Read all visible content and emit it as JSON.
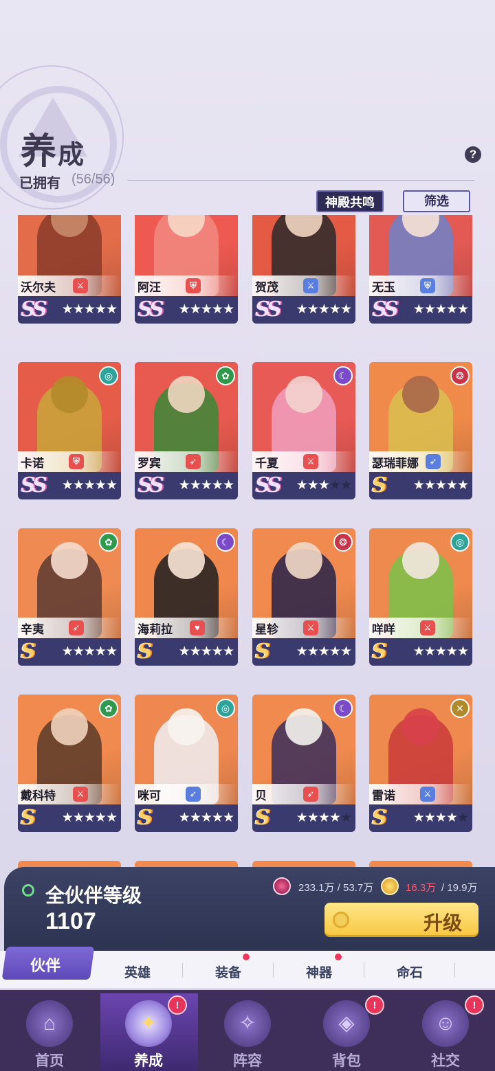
{
  "header": {
    "title_big": "养",
    "title_small": "成",
    "owned_label": "已拥有",
    "owned_count": "(56/56)",
    "help": "?",
    "temple_button": "神殿共鸣",
    "filter_button": "筛选"
  },
  "companions": [
    {
      "name": "沃尔夫",
      "rank": "SS",
      "stars": 5,
      "role_icon": "sword-icon",
      "role_color": "#e85050",
      "elem_icon": "",
      "bg": "#e36d4a",
      "figure": "#8a3a2a",
      "head": "#c98a6a"
    },
    {
      "name": "阿汪",
      "rank": "SS",
      "stars": 5,
      "role_icon": "shield-icon",
      "role_color": "#e85050",
      "elem_icon": "",
      "bg": "#ee5a52",
      "figure": "#f08a80",
      "head": "#f6d7c6"
    },
    {
      "name": "贺茂",
      "rank": "SS",
      "stars": 5,
      "role_icon": "sword-icon",
      "role_color": "#5a7de0",
      "elem_icon": "",
      "bg": "#e35a45",
      "figure": "#2a2a2a",
      "head": "#f2d6c2"
    },
    {
      "name": "无玉",
      "rank": "SS",
      "stars": 5,
      "role_icon": "shield-icon",
      "role_color": "#5a7de0",
      "elem_icon": "",
      "bg": "#e35a55",
      "figure": "#6f83c9",
      "head": "#f6e2d6"
    },
    {
      "name": "卡诺",
      "rank": "SS",
      "stars": 5,
      "role_icon": "shield-icon",
      "role_color": "#e85050",
      "elem_icon": "wind-icon",
      "elem_color": "#2ea39a",
      "bg": "#e55d49",
      "figure": "#c9a43a",
      "head": "#b48a2a"
    },
    {
      "name": "罗宾",
      "rank": "SS",
      "stars": 5,
      "role_icon": "bow-icon",
      "role_color": "#e85050",
      "elem_icon": "leaf-icon",
      "elem_color": "#2f9a4e",
      "bg": "#e85a4f",
      "figure": "#3a8a3a",
      "head": "#f0d6c0"
    },
    {
      "name": "千夏",
      "rank": "SS",
      "stars": 3,
      "role_icon": "sword-icon",
      "role_color": "#e85050",
      "elem_icon": "moon-icon",
      "elem_color": "#7a4ac8",
      "bg": "#e85a55",
      "figure": "#f0a0c0",
      "head": "#f3d2cf"
    },
    {
      "name": "瑟瑞菲娜",
      "rank": "S",
      "stars": 5,
      "role_icon": "bow-icon",
      "role_color": "#5a7de0",
      "elem_icon": "fire-icon",
      "elem_color": "#c8344a",
      "bg": "#f08a4a",
      "figure": "#d8c050",
      "head": "#a8684a"
    },
    {
      "name": "辛夷",
      "rank": "S",
      "stars": 5,
      "role_icon": "bow-icon",
      "role_color": "#e85050",
      "elem_icon": "leaf-icon",
      "elem_color": "#2f9a4e",
      "bg": "#ef8b52",
      "figure": "#5a3a32",
      "head": "#f5dccd"
    },
    {
      "name": "海莉拉",
      "rank": "S",
      "stars": 5,
      "role_icon": "heart-icon",
      "role_color": "#e85050",
      "elem_icon": "moon-icon",
      "elem_color": "#7a4ac8",
      "bg": "#f0884e",
      "figure": "#1e1e22",
      "head": "#f8e6d6"
    },
    {
      "name": "星轸",
      "rank": "S",
      "stars": 5,
      "role_icon": "sword-icon",
      "role_color": "#e85050",
      "elem_icon": "fire-icon",
      "elem_color": "#c8344a",
      "bg": "#f08a4e",
      "figure": "#26224a",
      "head": "#f2d8c8"
    },
    {
      "name": "咩咩",
      "rank": "S",
      "stars": 5,
      "role_icon": "sword-icon",
      "role_color": "#e85050",
      "elem_icon": "wind-icon",
      "elem_color": "#2ea39a",
      "bg": "#ef8a4e",
      "figure": "#7ac24a",
      "head": "#f2e8e0"
    },
    {
      "name": "戴科特",
      "rank": "S",
      "stars": 5,
      "role_icon": "sword-icon",
      "role_color": "#e85050",
      "elem_icon": "leaf-icon",
      "elem_color": "#2f9a4e",
      "bg": "#f08a4e",
      "figure": "#5a3a2a",
      "head": "#f0d2bc"
    },
    {
      "name": "咪可",
      "rank": "S",
      "stars": 5,
      "role_icon": "bow-icon",
      "role_color": "#5a7de0",
      "elem_icon": "wind-icon",
      "elem_color": "#2ea39a",
      "bg": "#ef8850",
      "figure": "#eef0f4",
      "head": "#f8f4f0"
    },
    {
      "name": "贝",
      "rank": "S",
      "stars": 4,
      "role_icon": "bow-icon",
      "role_color": "#e85050",
      "elem_icon": "moon-icon",
      "elem_color": "#7a4ac8",
      "bg": "#f08a4e",
      "figure": "#3a2e5a",
      "head": "#f4f2f0"
    },
    {
      "name": "雷诺",
      "rank": "S",
      "stars": 4,
      "role_icon": "sword-icon",
      "role_color": "#5a7de0",
      "elem_icon": "cross-icon",
      "elem_color": "#b08a2a",
      "bg": "#ef8a4e",
      "figure": "#c83a3a",
      "head": "#d8404a"
    }
  ],
  "panel": {
    "title": "全伙伴等级",
    "level": "1107",
    "res1": "233.1万 / 53.7万",
    "res2_have": "16.3万",
    "res2_need": "/ 19.9万",
    "upgrade": "升级"
  },
  "subtabs": {
    "active": "伙伴",
    "heroes": "英雄",
    "equipment": "装备",
    "artifacts": "神器",
    "fate_stone": "命石"
  },
  "nav": [
    {
      "label": "首页",
      "icon": "home-icon",
      "glyph": "⌂"
    },
    {
      "label": "养成",
      "icon": "cultivate-icon",
      "glyph": "✦"
    },
    {
      "label": "阵容",
      "icon": "lineup-icon",
      "glyph": "✧"
    },
    {
      "label": "背包",
      "icon": "bag-icon",
      "glyph": "◈"
    },
    {
      "label": "社交",
      "icon": "social-icon",
      "glyph": "☺"
    }
  ],
  "badges": {
    "cultivate": "!",
    "bag": "!",
    "social": "!"
  }
}
